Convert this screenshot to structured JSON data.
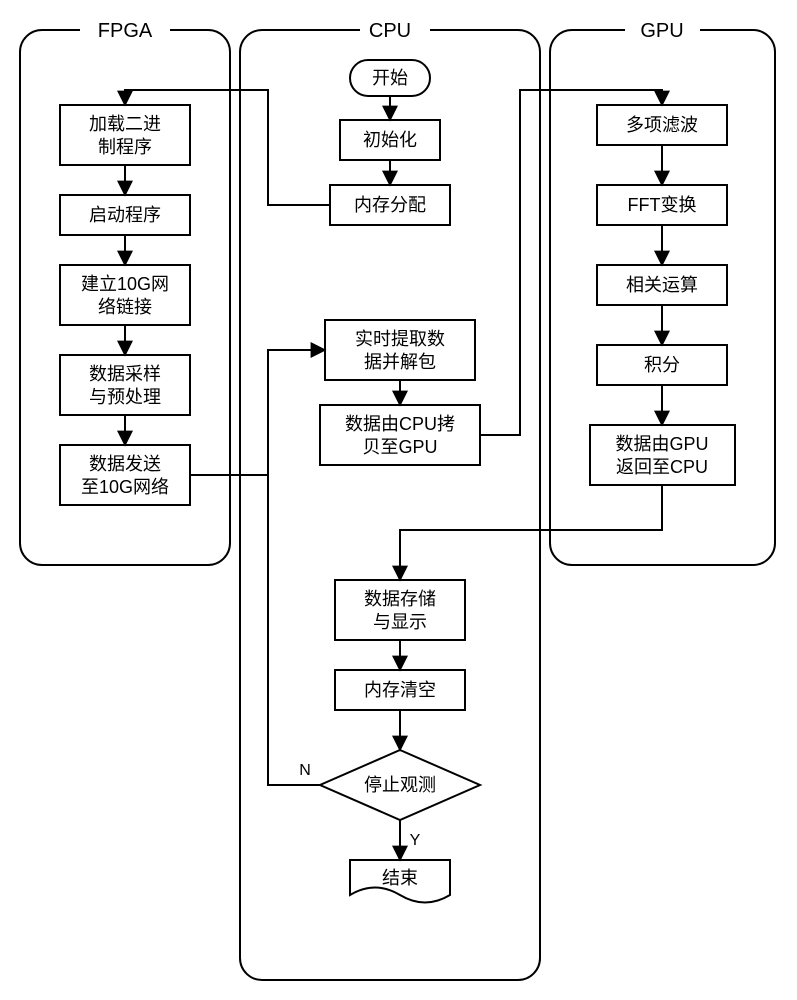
{
  "columns": {
    "fpga": "FPGA",
    "cpu": "CPU",
    "gpu": "GPU"
  },
  "fpga": {
    "b1l1": "加载二进",
    "b1l2": "制程序",
    "b2": "启动程序",
    "b3l1": "建立10G网",
    "b3l2": "络链接",
    "b4l1": "数据采样",
    "b4l2": "与预处理",
    "b5l1": "数据发送",
    "b5l2": "至10G网络"
  },
  "cpu": {
    "start": "开始",
    "init": "初始化",
    "malloc": "内存分配",
    "extractl1": "实时提取数",
    "extractl2": "据并解包",
    "copyl1": "数据由CPU拷",
    "copyl2": "贝至GPU",
    "storel1": "数据存储",
    "storel2": "与显示",
    "clear": "内存清空",
    "stop": "停止观测",
    "end": "结束",
    "N": "N",
    "Y": "Y"
  },
  "gpu": {
    "b1": "多项滤波",
    "b2": "FFT变换",
    "b3": "相关运算",
    "b4": "积分",
    "b5l1": "数据由GPU",
    "b5l2": "返回至CPU"
  },
  "chart_data": {
    "type": "flowchart",
    "swimlanes": [
      "FPGA",
      "CPU",
      "GPU"
    ],
    "nodes": [
      {
        "id": "start",
        "lane": "CPU",
        "label": "开始",
        "shape": "terminator"
      },
      {
        "id": "init",
        "lane": "CPU",
        "label": "初始化",
        "shape": "process"
      },
      {
        "id": "malloc",
        "lane": "CPU",
        "label": "内存分配",
        "shape": "process"
      },
      {
        "id": "f1",
        "lane": "FPGA",
        "label": "加载二进制程序",
        "shape": "process"
      },
      {
        "id": "f2",
        "lane": "FPGA",
        "label": "启动程序",
        "shape": "process"
      },
      {
        "id": "f3",
        "lane": "FPGA",
        "label": "建立10G网络链接",
        "shape": "process"
      },
      {
        "id": "f4",
        "lane": "FPGA",
        "label": "数据采样与预处理",
        "shape": "process"
      },
      {
        "id": "f5",
        "lane": "FPGA",
        "label": "数据发送至10G网络",
        "shape": "process"
      },
      {
        "id": "extract",
        "lane": "CPU",
        "label": "实时提取数据并解包",
        "shape": "process"
      },
      {
        "id": "copy",
        "lane": "CPU",
        "label": "数据由CPU拷贝至GPU",
        "shape": "process"
      },
      {
        "id": "g1",
        "lane": "GPU",
        "label": "多项滤波",
        "shape": "process"
      },
      {
        "id": "g2",
        "lane": "GPU",
        "label": "FFT变换",
        "shape": "process"
      },
      {
        "id": "g3",
        "lane": "GPU",
        "label": "相关运算",
        "shape": "process"
      },
      {
        "id": "g4",
        "lane": "GPU",
        "label": "积分",
        "shape": "process"
      },
      {
        "id": "g5",
        "lane": "GPU",
        "label": "数据由GPU返回至CPU",
        "shape": "process"
      },
      {
        "id": "store",
        "lane": "CPU",
        "label": "数据存储与显示",
        "shape": "process"
      },
      {
        "id": "clear",
        "lane": "CPU",
        "label": "内存清空",
        "shape": "process"
      },
      {
        "id": "stop",
        "lane": "CPU",
        "label": "停止观测",
        "shape": "decision"
      },
      {
        "id": "end",
        "lane": "CPU",
        "label": "结束",
        "shape": "terminator"
      }
    ],
    "edges": [
      {
        "from": "start",
        "to": "init"
      },
      {
        "from": "init",
        "to": "malloc"
      },
      {
        "from": "malloc",
        "to": "f1"
      },
      {
        "from": "f1",
        "to": "f2"
      },
      {
        "from": "f2",
        "to": "f3"
      },
      {
        "from": "f3",
        "to": "f4"
      },
      {
        "from": "f4",
        "to": "f5"
      },
      {
        "from": "f5",
        "to": "extract"
      },
      {
        "from": "extract",
        "to": "copy"
      },
      {
        "from": "copy",
        "to": "g1"
      },
      {
        "from": "g1",
        "to": "g2"
      },
      {
        "from": "g2",
        "to": "g3"
      },
      {
        "from": "g3",
        "to": "g4"
      },
      {
        "from": "g4",
        "to": "g5"
      },
      {
        "from": "g5",
        "to": "store"
      },
      {
        "from": "store",
        "to": "clear"
      },
      {
        "from": "clear",
        "to": "stop"
      },
      {
        "from": "stop",
        "to": "end",
        "label": "Y"
      },
      {
        "from": "stop",
        "to": "extract",
        "label": "N"
      }
    ]
  }
}
